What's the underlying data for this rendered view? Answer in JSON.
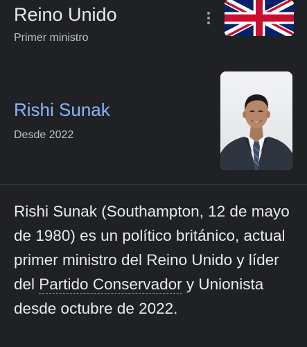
{
  "header": {
    "title": "Reino Unido",
    "subtitle": "Primer ministro",
    "more_icon": "more-vert-icon",
    "flag": "uk-flag"
  },
  "person": {
    "name": "Rishi Sunak",
    "since": "Desde 2022",
    "photo": "portrait-photo"
  },
  "description": {
    "part1": "Rishi Sunak (Southampton, 12 de mayo de 1980) es un político británico, actual primer ministro del Reino Unido y líder del ",
    "link1": "Partido Conservador",
    "part2": " y ",
    "link2": "Unionista",
    "part3": " desde octubre de 2022."
  },
  "colors": {
    "background": "#202124",
    "text": "#e8eaed",
    "secondary_text": "#bdc1c6",
    "link_blue": "#8ab4f8",
    "divider": "#3c4043"
  }
}
